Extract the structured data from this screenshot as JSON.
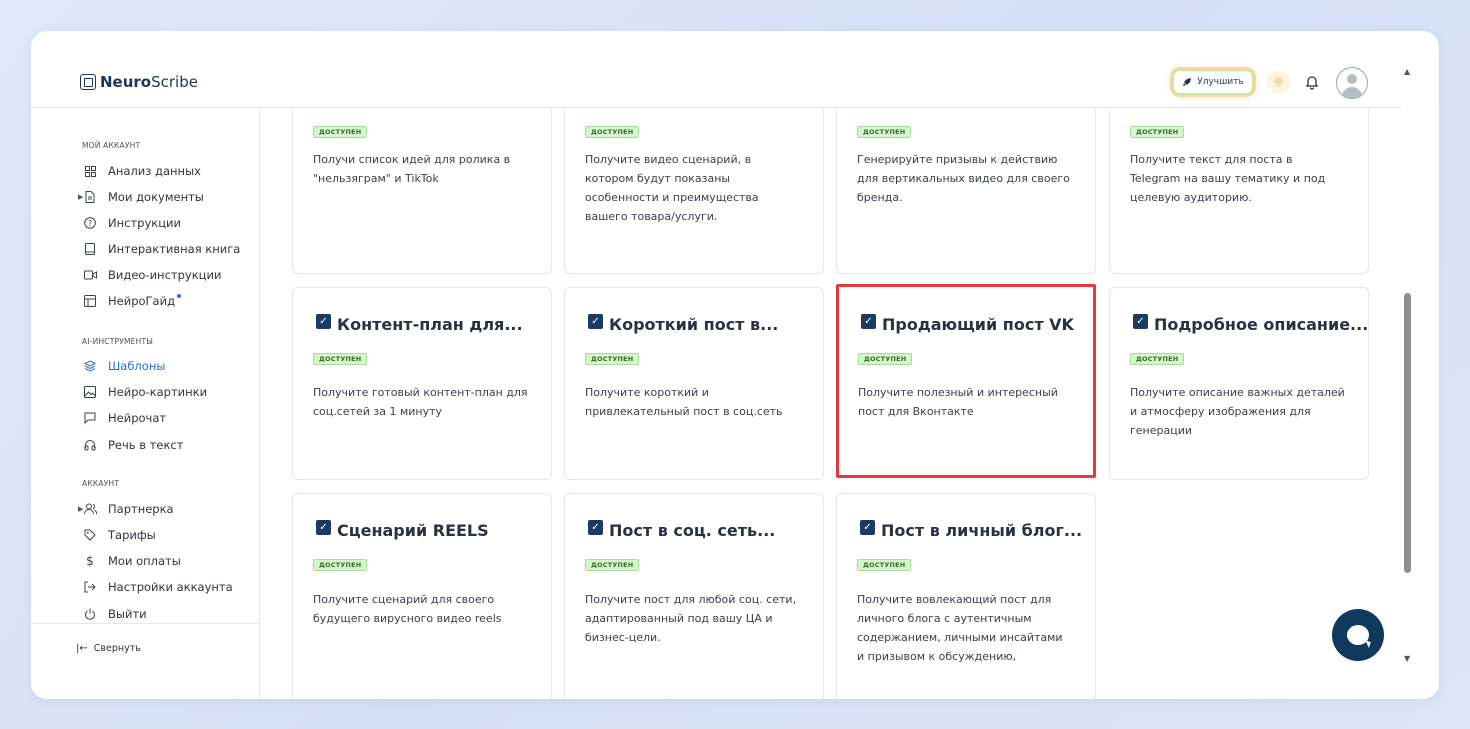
{
  "header": {
    "logo_bold": "Neuro",
    "logo_light": "Scribe",
    "upgrade_label": "Улучшить"
  },
  "sidebar": {
    "section_account": "МОЙ АККАУНТ",
    "account_items": [
      {
        "label": "Анализ данных",
        "icon": "grid-icon"
      },
      {
        "label": "Мои документы",
        "icon": "document-icon"
      },
      {
        "label": "Инструкции",
        "icon": "help-circle-icon"
      },
      {
        "label": "Интерактивная книга",
        "icon": "book-icon"
      },
      {
        "label": "Видео-инструкции",
        "icon": "video-icon"
      },
      {
        "label": "НейроГайд",
        "icon": "guide-icon"
      }
    ],
    "section_ai": "AI-ИНСТРУМЕНТЫ",
    "ai_items": [
      {
        "label": "Шаблоны",
        "icon": "layers-icon"
      },
      {
        "label": "Нейро-картинки",
        "icon": "image-icon"
      },
      {
        "label": "Нейрочат",
        "icon": "chat-icon"
      },
      {
        "label": "Речь в текст",
        "icon": "headphones-icon"
      }
    ],
    "section_acc2": "АККАУНТ",
    "acc2_items": [
      {
        "label": "Партнерка",
        "icon": "users-icon"
      },
      {
        "label": "Тарифы",
        "icon": "tag-icon"
      },
      {
        "label": "Мои оплаты",
        "icon": "dollar-icon"
      },
      {
        "label": "Настройки аккаунта",
        "icon": "settings-icon"
      },
      {
        "label": "Выйти",
        "icon": "power-icon"
      }
    ],
    "collapse_label": "Свернуть"
  },
  "badge_label": "ДОСТУПЕН",
  "cards_row1": [
    {
      "desc": "Получи список идей для ролика в \"нельзяграм\" и TikTok"
    },
    {
      "desc": "Получите видео сценарий, в котором будут показаны особенности и преимущества вашего товара/услуги."
    },
    {
      "desc": "Генерируйте призывы к действию для вертикальных видео для своего бренда."
    },
    {
      "desc": "Получите текст для поста в Telegram на вашу тематику и под целевую аудиторию."
    }
  ],
  "cards_row2": [
    {
      "title": "Контент-план для...",
      "desc": "Получите готовый контент-план для соц.сетей за 1 минуту"
    },
    {
      "title": "Короткий пост в...",
      "desc": "Получите короткий и привлекательный пост в соц.сеть"
    },
    {
      "title": "Продающий пост VK",
      "desc": "Получите полезный и интересный пост для Вконтакте"
    },
    {
      "title": "Подробное описание...",
      "desc": "Получите описание важных деталей и атмосферу изображения для генерации"
    }
  ],
  "cards_row3": [
    {
      "title": "Сценарий REELS",
      "desc": "Получите сценарий для своего будущего вирусного видео reels"
    },
    {
      "title": "Пост в соц. сеть...",
      "desc": "Получите пост для любой соц. сети, адаптированный под вашу ЦА и бизнес-цели."
    },
    {
      "title": "Пост в личный блог...",
      "desc": "Получите вовлекающий пост для личного блога с аутентичным содержанием, личными инсайтами и призывом к обсуждению,"
    }
  ],
  "colors": {
    "accent": "#2a6fd6",
    "highlight": "#e63a3a",
    "badge_bg": "#d7f5cf",
    "chat_button": "#0f3a5e"
  }
}
